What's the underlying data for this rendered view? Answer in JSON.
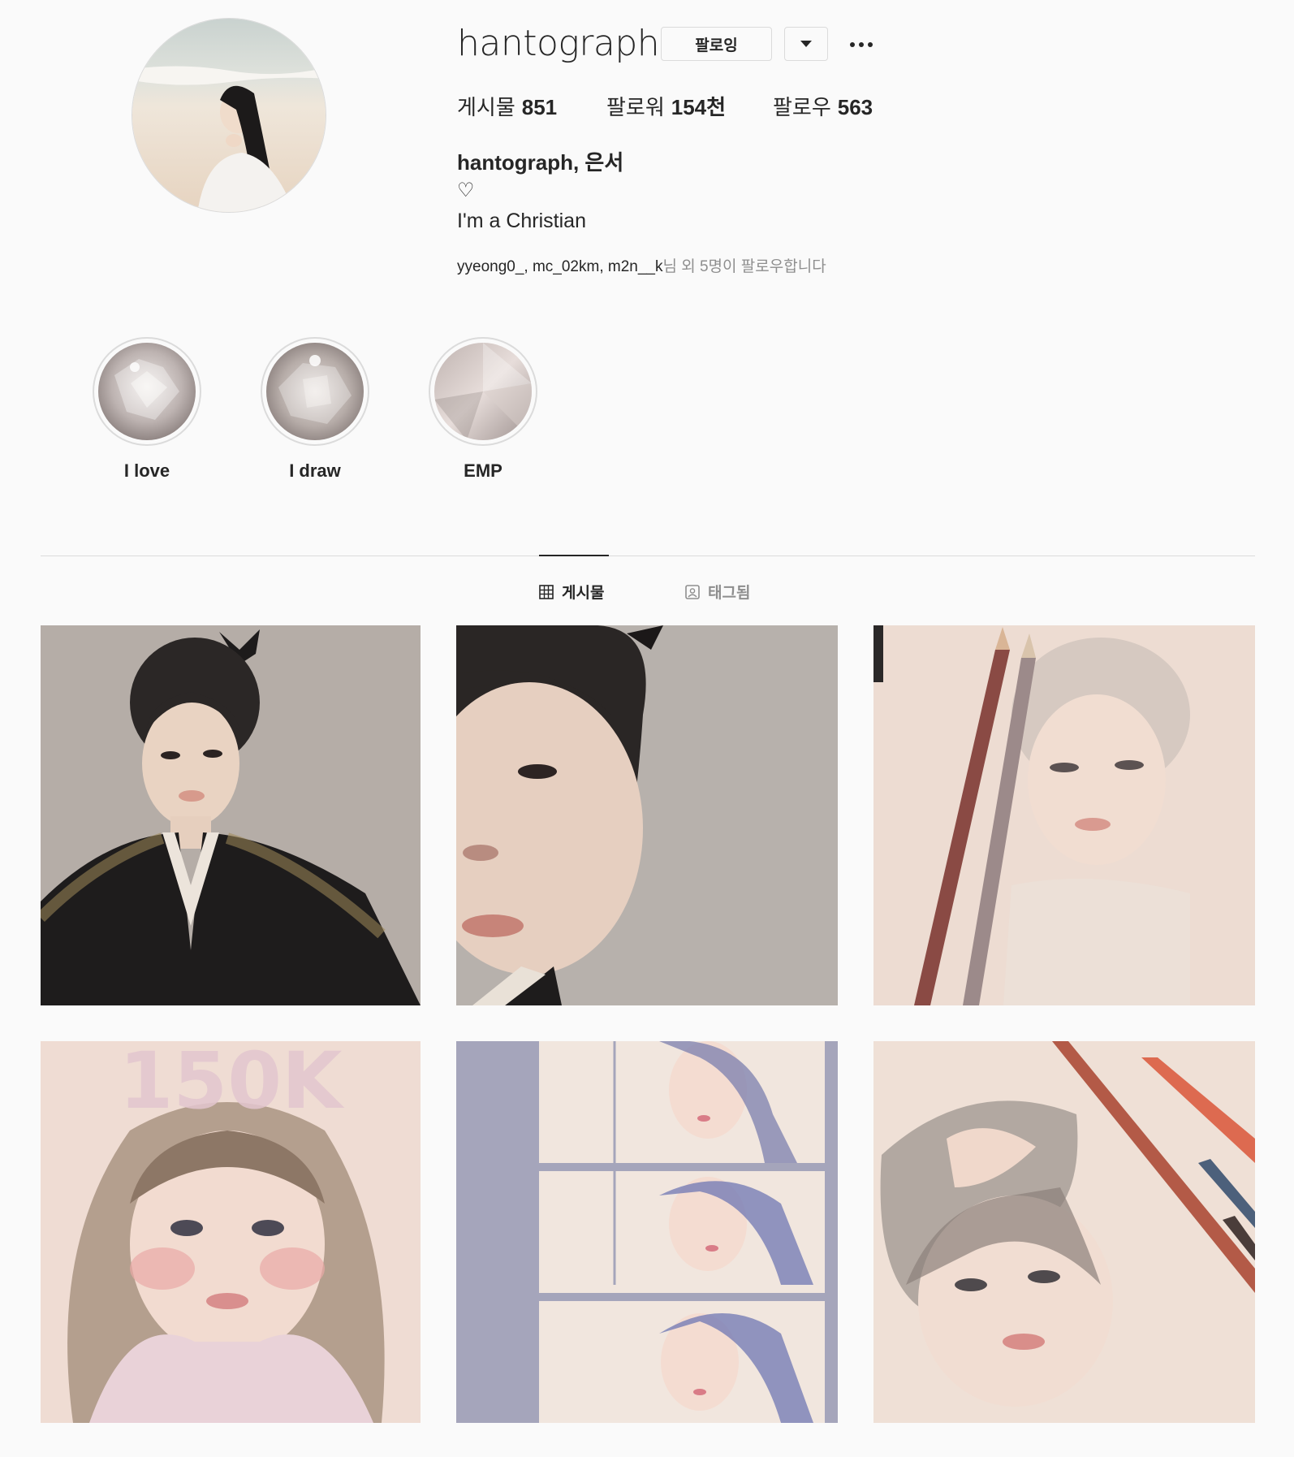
{
  "profile": {
    "username": "hantograph",
    "following_label": "팔로잉",
    "stats": {
      "posts_label": "게시물",
      "posts_value": "851",
      "followers_label": "팔로워",
      "followers_value": "154천",
      "following_label": "팔로우",
      "following_value": "563"
    },
    "full_name": "hantograph, 은서",
    "bio_heart": "♡",
    "bio_line": "I'm a Christian",
    "followed_by_names": "yyeong0_, mc_02km, m2n__k",
    "followed_by_suffix": "님 외 5명이 팔로우합니다"
  },
  "highlights": [
    {
      "label": "I love"
    },
    {
      "label": "I draw"
    },
    {
      "label": "EMP"
    }
  ],
  "tabs": {
    "posts": "게시물",
    "tagged": "태그됨"
  },
  "posts": [
    {
      "overlay_text": ""
    },
    {
      "overlay_text": ""
    },
    {
      "overlay_text": ""
    },
    {
      "overlay_text": "150K"
    },
    {
      "overlay_text": ""
    },
    {
      "overlay_text": ""
    }
  ],
  "colors": {
    "background": "#fafafa",
    "text": "#262626",
    "secondary_text": "#8e8e8e",
    "border": "#dbdbdb"
  }
}
